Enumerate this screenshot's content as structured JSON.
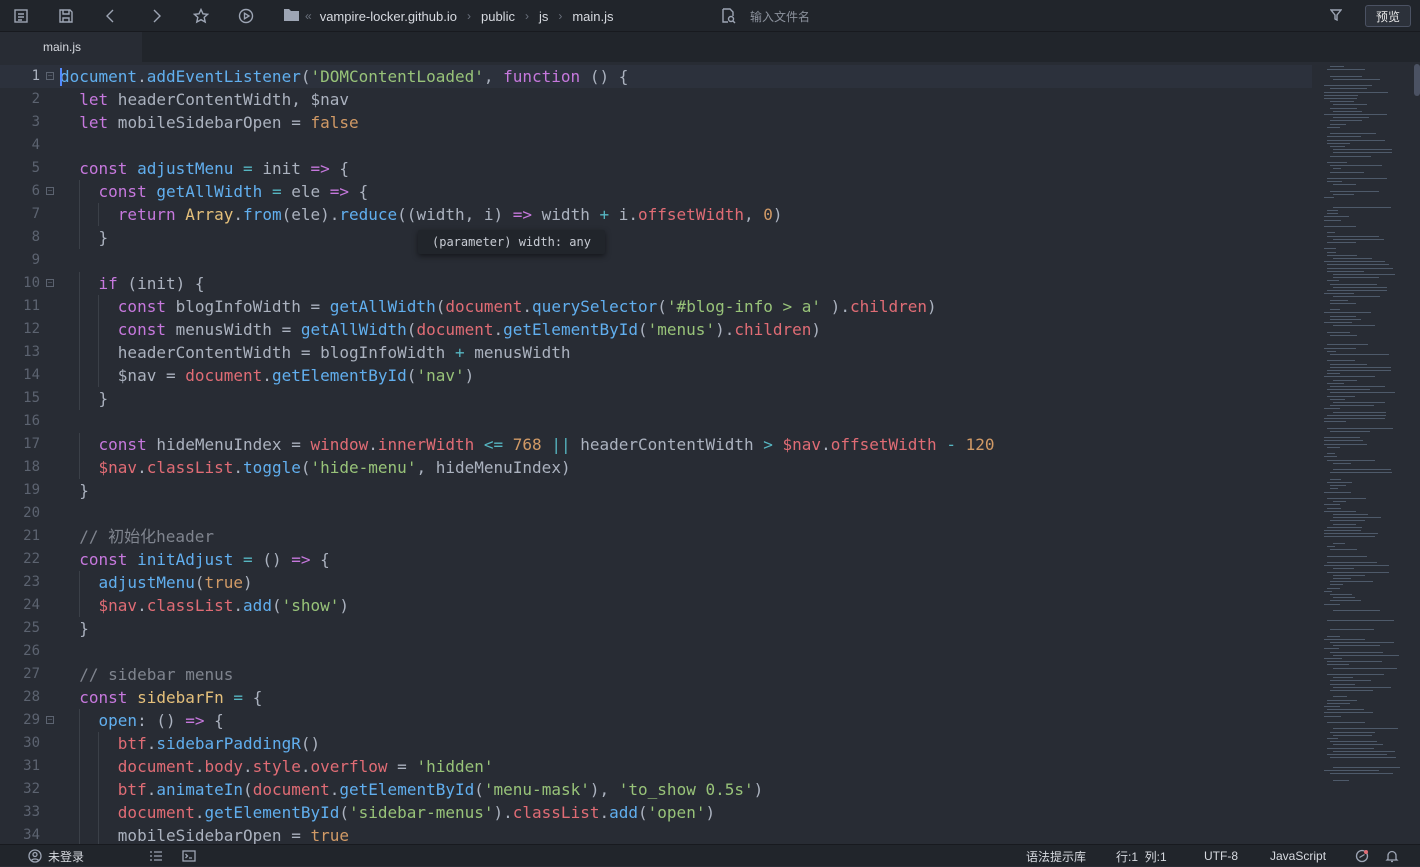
{
  "toolbar": {
    "breadcrumb": [
      "vampire-locker.github.io",
      "public",
      "js",
      "main.js"
    ],
    "back_glyph": "«",
    "search_placeholder": "输入文件名",
    "preview_label": "预览"
  },
  "tabs": [
    {
      "label": "main.js"
    }
  ],
  "editor": {
    "tooltip": "(parameter) width: any",
    "lines": [
      {
        "n": "1",
        "fold": true,
        "segs": [
          [
            "f",
            "document"
          ],
          [
            "",
            "."
          ],
          [
            "f",
            "addEventListener"
          ],
          [
            "",
            "("
          ],
          [
            "s",
            "'DOMContentLoaded'"
          ],
          [
            "",
            ", "
          ],
          [
            "k",
            "function"
          ],
          [
            "",
            " () {"
          ]
        ]
      },
      {
        "n": "2",
        "segs": [
          [
            "",
            "  "
          ],
          [
            "k",
            "let"
          ],
          [
            "",
            " headerContentWidth, $nav"
          ]
        ]
      },
      {
        "n": "3",
        "segs": [
          [
            "",
            "  "
          ],
          [
            "k",
            "let"
          ],
          [
            "",
            " mobileSidebarOpen = "
          ],
          [
            "n",
            "false"
          ]
        ]
      },
      {
        "n": "4",
        "segs": []
      },
      {
        "n": "5",
        "segs": [
          [
            "",
            "  "
          ],
          [
            "k",
            "const"
          ],
          [
            "",
            " "
          ],
          [
            "f",
            "adjustMenu"
          ],
          [
            "",
            " "
          ],
          [
            "o",
            "="
          ],
          [
            "",
            " init "
          ],
          [
            "k",
            "=>"
          ],
          [
            "",
            " {"
          ]
        ]
      },
      {
        "n": "6",
        "fold": true,
        "segs": [
          [
            "",
            "    "
          ],
          [
            "k",
            "const"
          ],
          [
            "",
            " "
          ],
          [
            "f",
            "getAllWidth"
          ],
          [
            "",
            " "
          ],
          [
            "o",
            "="
          ],
          [
            "",
            " ele "
          ],
          [
            "k",
            "=>"
          ],
          [
            "",
            " {"
          ]
        ]
      },
      {
        "n": "7",
        "segs": [
          [
            "",
            "      "
          ],
          [
            "k",
            "return"
          ],
          [
            "",
            " "
          ],
          [
            "y",
            "Array"
          ],
          [
            "",
            "."
          ],
          [
            "f",
            "from"
          ],
          [
            "",
            "(ele)."
          ],
          [
            "f",
            "reduce"
          ],
          [
            "",
            "((width, i) "
          ],
          [
            "k",
            "=>"
          ],
          [
            "",
            " width "
          ],
          [
            "o",
            "+"
          ],
          [
            "",
            " i."
          ],
          [
            "v",
            "offsetWidth"
          ],
          [
            "",
            ", "
          ],
          [
            "n",
            "0"
          ],
          [
            "",
            ")"
          ]
        ]
      },
      {
        "n": "8",
        "segs": [
          [
            "",
            "    }"
          ]
        ]
      },
      {
        "n": "9",
        "segs": []
      },
      {
        "n": "10",
        "fold": true,
        "segs": [
          [
            "",
            "    "
          ],
          [
            "k",
            "if"
          ],
          [
            "",
            " (init) {"
          ]
        ]
      },
      {
        "n": "11",
        "segs": [
          [
            "",
            "      "
          ],
          [
            "k",
            "const"
          ],
          [
            "",
            " blogInfoWidth = "
          ],
          [
            "f",
            "getAllWidth"
          ],
          [
            "",
            "("
          ],
          [
            "v",
            "document"
          ],
          [
            "",
            "."
          ],
          [
            "f",
            "querySelector"
          ],
          [
            "",
            "("
          ],
          [
            "s",
            "'#blog-info > a'"
          ],
          [
            "",
            " )."
          ],
          [
            "v",
            "children"
          ],
          [
            "",
            ")"
          ]
        ]
      },
      {
        "n": "12",
        "segs": [
          [
            "",
            "      "
          ],
          [
            "k",
            "const"
          ],
          [
            "",
            " menusWidth = "
          ],
          [
            "f",
            "getAllWidth"
          ],
          [
            "",
            "("
          ],
          [
            "v",
            "document"
          ],
          [
            "",
            "."
          ],
          [
            "f",
            "getElementById"
          ],
          [
            "",
            "("
          ],
          [
            "s",
            "'menus'"
          ],
          [
            "",
            ")."
          ],
          [
            "v",
            "children"
          ],
          [
            "",
            ")"
          ]
        ]
      },
      {
        "n": "13",
        "segs": [
          [
            "",
            "      headerContentWidth = blogInfoWidth "
          ],
          [
            "o",
            "+"
          ],
          [
            "",
            " menusWidth"
          ]
        ]
      },
      {
        "n": "14",
        "segs": [
          [
            "",
            "      $nav = "
          ],
          [
            "v",
            "document"
          ],
          [
            "",
            "."
          ],
          [
            "f",
            "getElementById"
          ],
          [
            "",
            "("
          ],
          [
            "s",
            "'nav'"
          ],
          [
            "",
            ")"
          ]
        ]
      },
      {
        "n": "15",
        "segs": [
          [
            "",
            "    }"
          ]
        ]
      },
      {
        "n": "16",
        "segs": []
      },
      {
        "n": "17",
        "segs": [
          [
            "",
            "    "
          ],
          [
            "k",
            "const"
          ],
          [
            "",
            " hideMenuIndex = "
          ],
          [
            "v",
            "window"
          ],
          [
            "",
            "."
          ],
          [
            "v",
            "innerWidth"
          ],
          [
            "",
            " "
          ],
          [
            "o",
            "<="
          ],
          [
            "",
            " "
          ],
          [
            "n",
            "768"
          ],
          [
            "",
            " "
          ],
          [
            "o",
            "||"
          ],
          [
            "",
            " headerContentWidth "
          ],
          [
            "o",
            ">"
          ],
          [
            "",
            " "
          ],
          [
            "v",
            "$nav"
          ],
          [
            "",
            "."
          ],
          [
            "v",
            "offsetWidth"
          ],
          [
            "",
            " "
          ],
          [
            "o",
            "-"
          ],
          [
            "",
            " "
          ],
          [
            "n",
            "120"
          ]
        ]
      },
      {
        "n": "18",
        "segs": [
          [
            "",
            "    "
          ],
          [
            "v",
            "$nav"
          ],
          [
            "",
            "."
          ],
          [
            "v",
            "classList"
          ],
          [
            "",
            "."
          ],
          [
            "f",
            "toggle"
          ],
          [
            "",
            "("
          ],
          [
            "s",
            "'hide-menu'"
          ],
          [
            "",
            ", hideMenuIndex)"
          ]
        ]
      },
      {
        "n": "19",
        "segs": [
          [
            "",
            "  }"
          ]
        ]
      },
      {
        "n": "20",
        "segs": []
      },
      {
        "n": "21",
        "segs": [
          [
            "",
            "  "
          ],
          [
            "c",
            "// 初始化header"
          ]
        ]
      },
      {
        "n": "22",
        "segs": [
          [
            "",
            "  "
          ],
          [
            "k",
            "const"
          ],
          [
            "",
            " "
          ],
          [
            "f",
            "initAdjust"
          ],
          [
            "",
            " "
          ],
          [
            "o",
            "="
          ],
          [
            "",
            " () "
          ],
          [
            "k",
            "=>"
          ],
          [
            "",
            " {"
          ]
        ]
      },
      {
        "n": "23",
        "segs": [
          [
            "",
            "    "
          ],
          [
            "f",
            "adjustMenu"
          ],
          [
            "",
            "("
          ],
          [
            "n",
            "true"
          ],
          [
            "",
            ")"
          ]
        ]
      },
      {
        "n": "24",
        "segs": [
          [
            "",
            "    "
          ],
          [
            "v",
            "$nav"
          ],
          [
            "",
            "."
          ],
          [
            "v",
            "classList"
          ],
          [
            "",
            "."
          ],
          [
            "f",
            "add"
          ],
          [
            "",
            "("
          ],
          [
            "s",
            "'show'"
          ],
          [
            "",
            ")"
          ]
        ]
      },
      {
        "n": "25",
        "segs": [
          [
            "",
            "  }"
          ]
        ]
      },
      {
        "n": "26",
        "segs": []
      },
      {
        "n": "27",
        "segs": [
          [
            "",
            "  "
          ],
          [
            "c",
            "// sidebar menus"
          ]
        ]
      },
      {
        "n": "28",
        "segs": [
          [
            "",
            "  "
          ],
          [
            "k",
            "const"
          ],
          [
            "",
            " "
          ],
          [
            "y",
            "sidebarFn"
          ],
          [
            "",
            " "
          ],
          [
            "o",
            "="
          ],
          [
            "",
            " {"
          ]
        ]
      },
      {
        "n": "29",
        "fold": true,
        "segs": [
          [
            "",
            "    "
          ],
          [
            "f",
            "open"
          ],
          [
            "",
            ": () "
          ],
          [
            "k",
            "=>"
          ],
          [
            "",
            " {"
          ]
        ]
      },
      {
        "n": "30",
        "segs": [
          [
            "",
            "      "
          ],
          [
            "v",
            "btf"
          ],
          [
            "",
            "."
          ],
          [
            "f",
            "sidebarPaddingR"
          ],
          [
            "",
            "()"
          ]
        ]
      },
      {
        "n": "31",
        "segs": [
          [
            "",
            "      "
          ],
          [
            "v",
            "document"
          ],
          [
            "",
            "."
          ],
          [
            "v",
            "body"
          ],
          [
            "",
            "."
          ],
          [
            "v",
            "style"
          ],
          [
            "",
            "."
          ],
          [
            "v",
            "overflow"
          ],
          [
            "",
            " = "
          ],
          [
            "s",
            "'hidden'"
          ]
        ]
      },
      {
        "n": "32",
        "segs": [
          [
            "",
            "      "
          ],
          [
            "v",
            "btf"
          ],
          [
            "",
            "."
          ],
          [
            "f",
            "animateIn"
          ],
          [
            "",
            "("
          ],
          [
            "v",
            "document"
          ],
          [
            "",
            "."
          ],
          [
            "f",
            "getElementById"
          ],
          [
            "",
            "("
          ],
          [
            "s",
            "'menu-mask'"
          ],
          [
            "",
            "), "
          ],
          [
            "s",
            "'to_show 0.5s'"
          ],
          [
            "",
            ")"
          ]
        ]
      },
      {
        "n": "33",
        "segs": [
          [
            "",
            "      "
          ],
          [
            "v",
            "document"
          ],
          [
            "",
            "."
          ],
          [
            "f",
            "getElementById"
          ],
          [
            "",
            "("
          ],
          [
            "s",
            "'sidebar-menus'"
          ],
          [
            "",
            ")."
          ],
          [
            "v",
            "classList"
          ],
          [
            "",
            "."
          ],
          [
            "f",
            "add"
          ],
          [
            "",
            "("
          ],
          [
            "s",
            "'open'"
          ],
          [
            "",
            ")"
          ]
        ]
      },
      {
        "n": "34",
        "segs": [
          [
            "",
            "      mobileSidebarOpen = "
          ],
          [
            "n",
            "true"
          ]
        ]
      }
    ]
  },
  "statusbar": {
    "user": "未登录",
    "syntax_lib": "语法提示库",
    "position": "行:1  列:1",
    "encoding": "UTF-8",
    "language": "JavaScript"
  },
  "colors": {
    "background": "#282c34",
    "keyword": "#c678dd",
    "function": "#61afef",
    "string": "#98c379",
    "variable": "#e06c75",
    "number": "#d19a66"
  }
}
